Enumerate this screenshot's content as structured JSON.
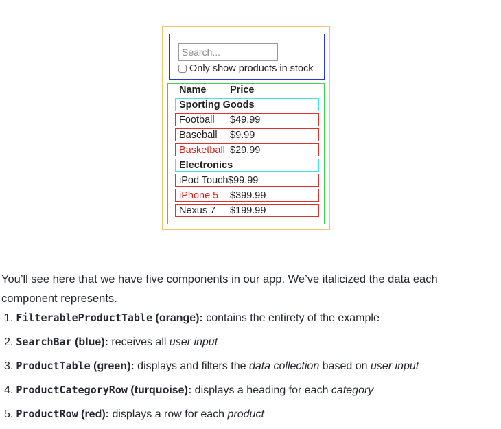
{
  "mockup": {
    "search_placeholder": "Search...",
    "stock_label": "Only show products in stock",
    "table_headers": [
      "Name",
      "Price"
    ],
    "rows": [
      {
        "kind": "category",
        "name": "Sporting Goods",
        "price": ""
      },
      {
        "kind": "product",
        "name": "Football",
        "price": "$49.99",
        "stocked": true
      },
      {
        "kind": "product",
        "name": "Baseball",
        "price": "$9.99",
        "stocked": true
      },
      {
        "kind": "product",
        "name": "Basketball",
        "price": "$29.99",
        "stocked": false
      },
      {
        "kind": "category",
        "name": "Electronics",
        "price": ""
      },
      {
        "kind": "product",
        "name": "iPod Touch",
        "price": "$99.99",
        "stocked": true
      },
      {
        "kind": "product",
        "name": "iPhone 5",
        "price": "$399.99",
        "stocked": false
      },
      {
        "kind": "product",
        "name": "Nexus 7",
        "price": "$199.99",
        "stocked": true
      }
    ]
  },
  "paragraph": "You’ll see here that we have five components in our app. We’ve italicized the data each component represents.",
  "components": [
    {
      "num": "1.",
      "code": "FilterableProductTable",
      "color": "(orange):",
      "text": " contains the entirety of the example",
      "italic": "",
      "after": ""
    },
    {
      "num": "2.",
      "code": "SearchBar",
      "color": "(blue):",
      "text": " receives all ",
      "italic": "user input",
      "after": ""
    },
    {
      "num": "3.",
      "code": "ProductTable",
      "color": "(green):",
      "text": " displays and filters the ",
      "italic": "data collection",
      "after": " based on ",
      "italic2": "user input"
    },
    {
      "num": "4.",
      "code": "ProductCategoryRow",
      "color": "(turquoise):",
      "text": " displays a heading for each ",
      "italic": "category",
      "after": ""
    },
    {
      "num": "5.",
      "code": "ProductRow",
      "color": "(red):",
      "text": " displays a row for each ",
      "italic": "product",
      "after": ""
    }
  ],
  "colors": {
    "orange": "#f7c36a",
    "blue": "#2a34d8",
    "green": "#37d64a",
    "turquoise": "#3ee7e4",
    "red": "#e0312f"
  }
}
